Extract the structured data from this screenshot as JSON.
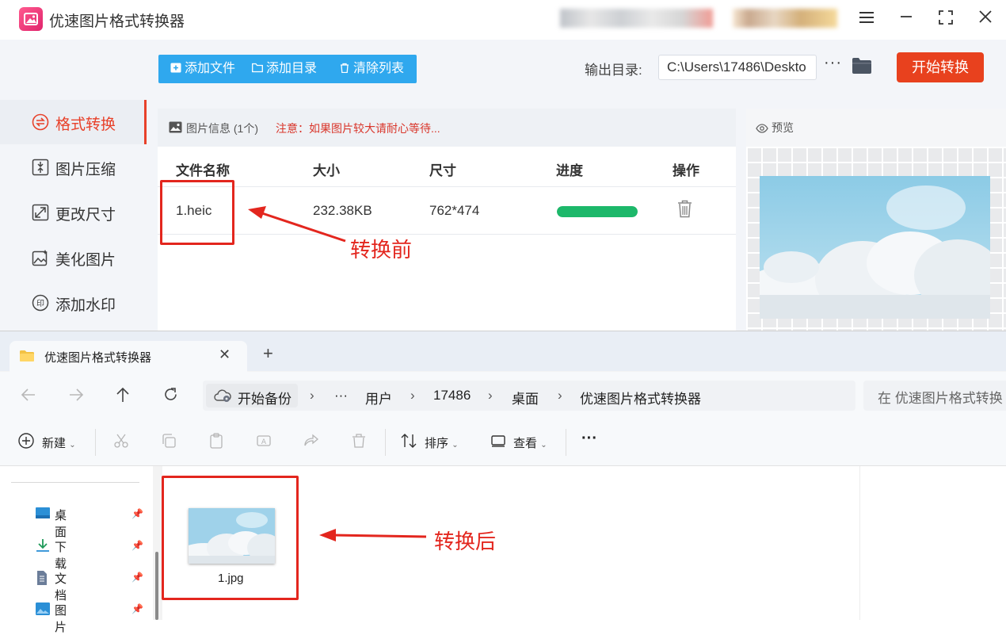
{
  "app": {
    "title": "优速图片格式转换器",
    "menu_icon": "hamburger-menu-icon",
    "window_controls": [
      "minimize-icon",
      "maximize-icon",
      "close-icon"
    ]
  },
  "sidebar": {
    "items": [
      {
        "label": "格式转换",
        "icon": "format-convert-icon",
        "active": true
      },
      {
        "label": "图片压缩",
        "icon": "compress-icon",
        "active": false
      },
      {
        "label": "更改尺寸",
        "icon": "resize-icon",
        "active": false
      },
      {
        "label": "美化图片",
        "icon": "beautify-icon",
        "active": false
      },
      {
        "label": "添加水印",
        "icon": "watermark-icon",
        "active": false
      }
    ]
  },
  "toolbar": {
    "add_file": "添加文件",
    "add_folder": "添加目录",
    "clear_list": "清除列表",
    "output_label": "输出目录:",
    "output_path": "C:\\Users\\17486\\Deskto",
    "more": "···",
    "start": "开始转换"
  },
  "file_list": {
    "header_title": "图片信息",
    "header_count": "(1个)",
    "header_note": "注意：如果图片较大请耐心等待...",
    "columns": [
      "文件名称",
      "大小",
      "尺寸",
      "进度",
      "操作"
    ],
    "rows": [
      {
        "name": "1.heic",
        "size": "232.38KB",
        "dims": "762*474",
        "progress": 1.0
      }
    ]
  },
  "preview": {
    "title": "预览"
  },
  "annotations": {
    "before": "转换前",
    "after": "转换后"
  },
  "colors": {
    "accent_red": "#e8411e",
    "toolbar_blue": "#2fa8ee",
    "progress_green": "#1db86a",
    "annotation_red": "#e3261e"
  },
  "explorer": {
    "tab_title": "优速图片格式转换器",
    "tab_close": "✕",
    "new_tab": "+",
    "breadcrumb": {
      "home": "开始备份",
      "ellipsis": "···",
      "items": [
        "用户",
        "17486",
        "桌面",
        "优速图片格式转换器"
      ]
    },
    "search_placeholder": "在 优速图片格式转换",
    "commands": {
      "new": "新建",
      "sort": "排序",
      "view": "查看",
      "more": "···"
    },
    "quick_access": [
      {
        "label": "桌面",
        "icon": "desktop-icon"
      },
      {
        "label": "下载",
        "icon": "download-icon"
      },
      {
        "label": "文档",
        "icon": "document-icon"
      },
      {
        "label": "图片",
        "icon": "pictures-icon"
      }
    ],
    "files": [
      {
        "name": "1.jpg"
      }
    ]
  }
}
